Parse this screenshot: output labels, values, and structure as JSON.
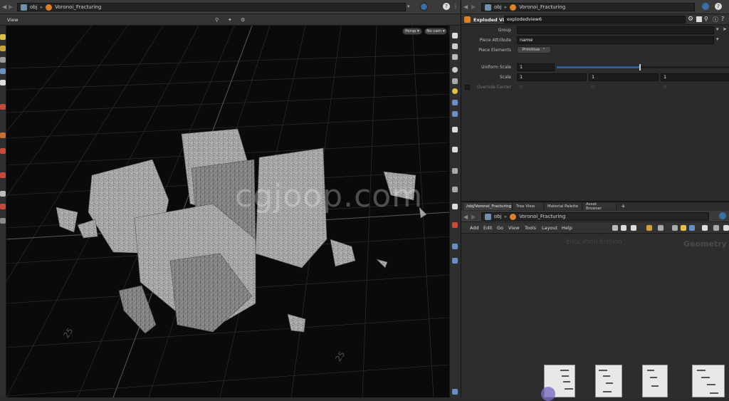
{
  "left_pane": {
    "path_root": "obj",
    "path_node": "Voronoi_Fracturing",
    "viewport_label": "View",
    "camera_menu": "Persp ▾",
    "cam_menu": "No cam ▾",
    "grid_label_a": "25",
    "grid_label_b": "25"
  },
  "right_top": {
    "path_root": "obj",
    "path_node": "Voronoi_Fracturing",
    "node_type": "Exploded View",
    "node_name": "explodedview6",
    "params": {
      "group_label": "Group",
      "group_value": "",
      "piece_attr_label": "Piece Attribute",
      "piece_attr_value": "name",
      "piece_elements_label": "Piece Elements",
      "piece_elements_value": "Primitive",
      "uniform_scale_label": "Uniform Scale",
      "uniform_scale_value": "1",
      "uniform_scale_fraction": 0.48,
      "scale_label": "Scale",
      "scale_x": "1",
      "scale_y": "1",
      "scale_z": "1",
      "override_center_label": "Override Center",
      "center_x": "0",
      "center_y": "0",
      "center_z": "0"
    }
  },
  "right_bottom": {
    "tabs": [
      "/obj/Voronoi_Fracturing",
      "Tree View",
      "Material Palette",
      "Asset Browser"
    ],
    "path_root": "obj",
    "path_node": "Voronoi_Fracturing",
    "menu": [
      "Add",
      "Edit",
      "Go",
      "View",
      "Tools",
      "Layout",
      "Help"
    ],
    "watermark_edition": "Education Edition",
    "network_context": "Geometry"
  },
  "overlay_watermark": "cgjoop.com",
  "colors": {
    "panel_bg": "#2b2b2b",
    "toolbar_bg": "#3a3a3a",
    "viewport_bg": "#0a0a0a",
    "grid": "#3c3c3c",
    "geo": "#a9a9a9",
    "slider": "#2f5d9a"
  }
}
